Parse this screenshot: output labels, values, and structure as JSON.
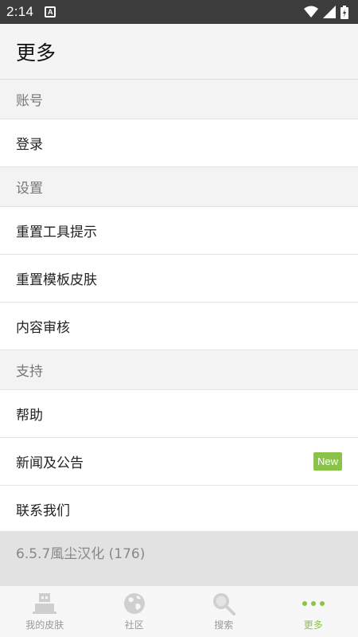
{
  "status_bar": {
    "time": "2:14",
    "notification_icon": "A"
  },
  "header": {
    "title": "更多"
  },
  "sections": {
    "account": {
      "title": "账号",
      "items": [
        "登录"
      ]
    },
    "settings": {
      "title": "设置",
      "items": [
        "重置工具提示",
        "重置模板皮肤",
        "内容审核"
      ]
    },
    "support": {
      "title": "支持",
      "items": [
        "帮助",
        "新闻及公告",
        "联系我们"
      ],
      "new_badge": "New"
    }
  },
  "version": "6.5.7風尘汉化 (176)",
  "bottom_nav": {
    "items": [
      {
        "label": "我的皮肤",
        "icon": "skins-icon"
      },
      {
        "label": "社区",
        "icon": "globe-icon"
      },
      {
        "label": "搜索",
        "icon": "search-icon"
      },
      {
        "label": "更多",
        "icon": "more-icon"
      }
    ],
    "active": "更多"
  },
  "colors": {
    "accent": "#8bc34a",
    "status_bar": "#3c3c3c",
    "inactive_icon": "#cfcfcf"
  }
}
